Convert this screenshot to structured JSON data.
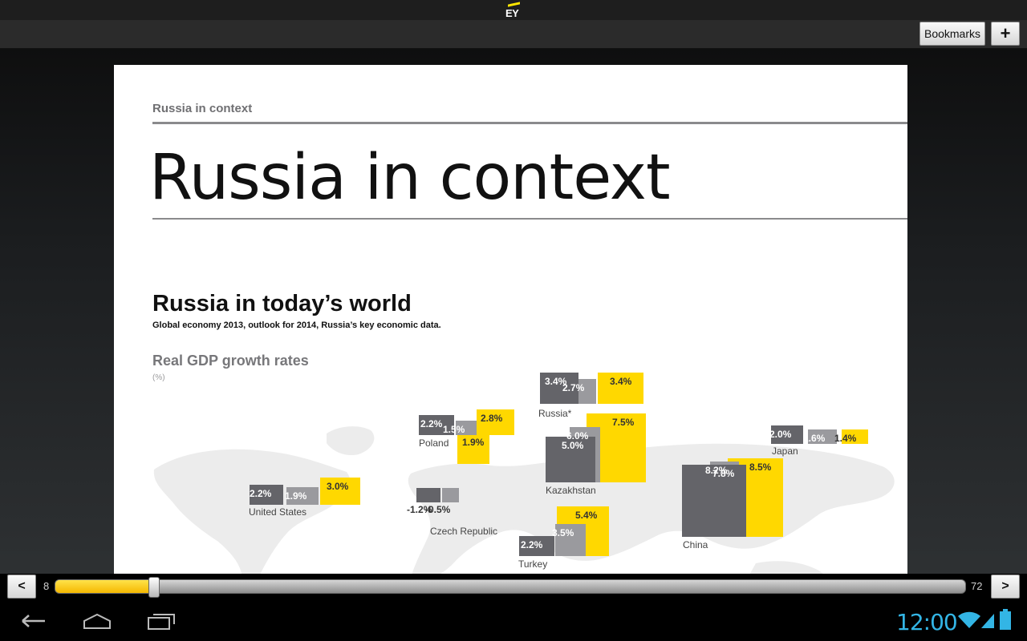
{
  "app": {
    "logo_text": "EY"
  },
  "toolbar": {
    "bookmarks_label": "Bookmarks",
    "add_label": "+"
  },
  "page": {
    "breadcrumb": "Russia in context",
    "title": "Russia in context",
    "section_title": "Russia in today’s world",
    "section_subtitle": "Global economy 2013, outlook for 2014, Russia’s key economic data.",
    "chart_title": "Real GDP growth rates",
    "chart_unit": "(%)"
  },
  "chart_data": {
    "type": "bar",
    "title": "Real GDP growth rates",
    "unit": "(%)",
    "series_colors": [
      "#646469",
      "#9a9a9e",
      "#ffd800"
    ],
    "countries": [
      {
        "name": "Russia*",
        "values": [
          3.4,
          2.7,
          3.4
        ],
        "labels": [
          "3.4%",
          "2.7%",
          "3.4%"
        ]
      },
      {
        "name": "Poland",
        "values": [
          2.2,
          1.5,
          2.8
        ],
        "labels": [
          "2.2%",
          "1.5%",
          "2.8%"
        ]
      },
      {
        "name": "Japan",
        "values": [
          2.0,
          1.6,
          1.4
        ],
        "labels": [
          "2.0%",
          "1.6%",
          "1.4%"
        ]
      },
      {
        "name": "Kazakhstan",
        "values": [
          5.0,
          6.0,
          7.5
        ],
        "labels": [
          "5.0%",
          "6.0%",
          "7.5%"
        ]
      },
      {
        "name": "United States",
        "values": [
          2.2,
          1.9,
          3.0
        ],
        "labels": [
          "2.2%",
          "1.9%",
          "3.0%"
        ]
      },
      {
        "name": "Czech Republic",
        "values": [
          -1.2,
          -0.5,
          1.9
        ],
        "labels": [
          "-1.2%",
          "-0.5%",
          "1.9%"
        ]
      },
      {
        "name": "Turkey",
        "values": [
          2.2,
          3.5,
          5.4
        ],
        "labels": [
          "2.2%",
          "3.5%",
          "5.4%"
        ]
      },
      {
        "name": "China",
        "values": [
          7.8,
          8.2,
          8.5
        ],
        "labels": [
          "7.8%",
          "8.2%",
          "8.5%"
        ]
      }
    ]
  },
  "pager": {
    "prev_label": "<",
    "next_label": ">",
    "min": "8",
    "max": "72",
    "progress": 0.104
  },
  "system": {
    "clock": "12:00"
  }
}
